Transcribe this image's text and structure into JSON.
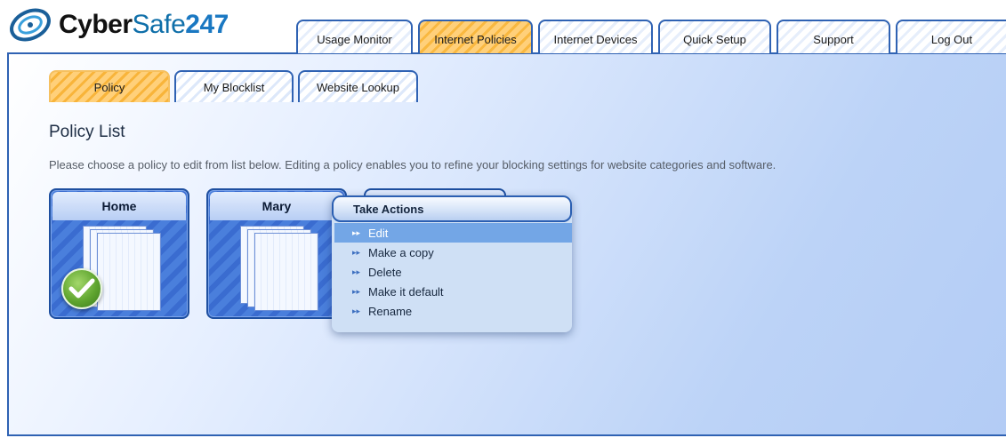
{
  "brand": {
    "name_part1": "Cyber",
    "name_part2": "Safe",
    "name_part3": "247"
  },
  "nav": {
    "tabs": [
      {
        "label": "Usage Monitor",
        "active": false
      },
      {
        "label": "Internet Policies",
        "active": true
      },
      {
        "label": "Internet Devices",
        "active": false
      },
      {
        "label": "Quick Setup",
        "active": false
      },
      {
        "label": "Support",
        "active": false
      },
      {
        "label": "Log Out",
        "active": false
      }
    ]
  },
  "subnav": {
    "tabs": [
      {
        "label": "Policy",
        "active": true
      },
      {
        "label": "My Blocklist",
        "active": false
      },
      {
        "label": "Website Lookup",
        "active": false
      }
    ]
  },
  "page": {
    "title": "Policy List",
    "description": "Please choose a policy to edit from list below. Editing a policy enables you to refine your blocking settings for website categories and software."
  },
  "policies": [
    {
      "name": "Home",
      "is_default": true,
      "icon": "document-stack-icon",
      "badge_icon": "checkmark-icon"
    },
    {
      "name": "Mary",
      "is_default": false,
      "icon": "document-stack-icon"
    }
  ],
  "context_menu": {
    "title": "Take Actions",
    "items": [
      {
        "label": "Edit",
        "highlighted": true
      },
      {
        "label": "Make a copy",
        "highlighted": false
      },
      {
        "label": "Delete",
        "highlighted": false
      },
      {
        "label": "Make it default",
        "highlighted": false
      },
      {
        "label": "Rename",
        "highlighted": false
      }
    ],
    "bullet_icon": "double-arrow-right-icon"
  },
  "colors": {
    "accent_blue": "#2f62b3",
    "active_tab_orange": "#f9b840",
    "card_blue": "#3a6cd0",
    "menu_highlight": "#73a6e6",
    "check_green": "#5fa52f"
  }
}
